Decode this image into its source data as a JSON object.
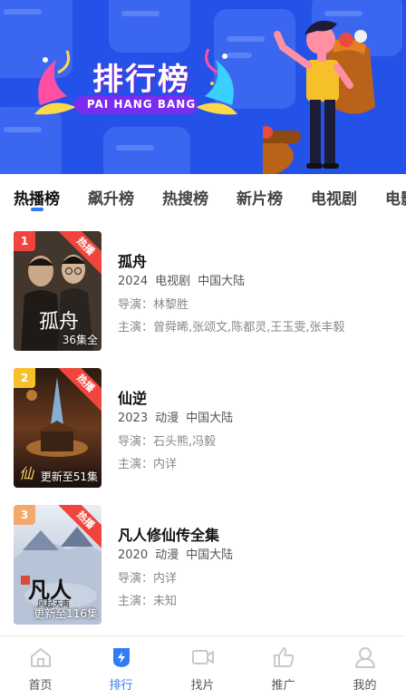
{
  "banner": {
    "title": "排行榜",
    "subtitle": "PAI HANG BANG"
  },
  "tabs": [
    "热播榜",
    "飙升榜",
    "热搜榜",
    "新片榜",
    "电视剧",
    "电影"
  ],
  "items": [
    {
      "rank": "1",
      "badge": "热播",
      "episodes": "36集全",
      "title": "孤舟",
      "year": "2024",
      "type": "电视剧",
      "region": "中国大陆",
      "director": "导演：林黎胜",
      "actors": "主演：曾舜晞,张颂文,陈都灵,王玉雯,张丰毅"
    },
    {
      "rank": "2",
      "badge": "热播",
      "episodes": "更新至51集",
      "title": "仙逆",
      "year": "2023",
      "type": "动漫",
      "region": "中国大陆",
      "director": "导演：石头熊,冯毅",
      "actors": "主演：内详"
    },
    {
      "rank": "3",
      "badge": "热播",
      "episodes": "更新至116集",
      "title": "凡人修仙传全集",
      "year": "2020",
      "type": "动漫",
      "region": "中国大陆",
      "director": "导演：内详",
      "actors": "主演：未知"
    }
  ],
  "poster_text": {
    "p1": "孤舟",
    "p3a": "凡人",
    "p3b": "风起天南"
  },
  "nav": [
    {
      "label": "首页",
      "icon": "home-icon"
    },
    {
      "label": "排行",
      "icon": "ranking-icon"
    },
    {
      "label": "找片",
      "icon": "video-camera-icon"
    },
    {
      "label": "推广",
      "icon": "thumbs-up-icon"
    },
    {
      "label": "我的",
      "icon": "person-icon"
    }
  ],
  "colors": {
    "accent": "#2f7cf6",
    "banner": "#2452e8",
    "rank1": "#f0453c",
    "rank2": "#f6c02a",
    "rank3": "#f4a86c",
    "badge": "#f0453c"
  }
}
